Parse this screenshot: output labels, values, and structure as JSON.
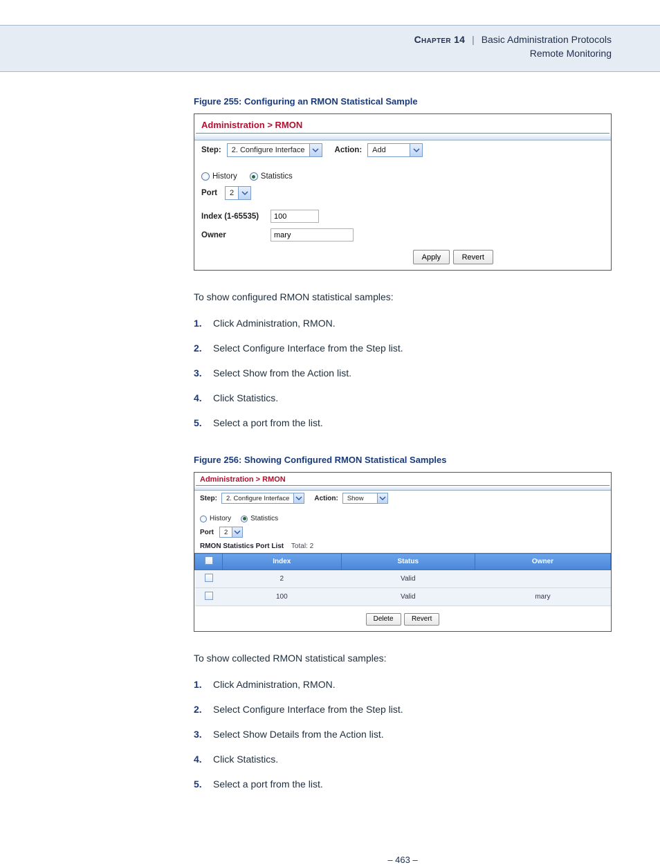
{
  "header": {
    "chapter_label": "Chapter 14",
    "chapter_title": "Basic Administration Protocols",
    "subtitle": "Remote Monitoring"
  },
  "figure255": {
    "caption": "Figure 255:  Configuring an RMON Statistical Sample",
    "breadcrumb": "Administration > RMON",
    "step_label": "Step:",
    "step_value": "2. Configure Interface",
    "action_label": "Action:",
    "action_value": "Add",
    "radio_history": "History",
    "radio_stats": "Statistics",
    "port_label": "Port",
    "port_value": "2",
    "index_label": "Index (1-65535)",
    "index_value": "100",
    "owner_label": "Owner",
    "owner_value": "mary",
    "apply_btn": "Apply",
    "revert_btn": "Revert"
  },
  "intro1": "To show configured RMON statistical samples:",
  "steps1": [
    "Click Administration, RMON.",
    "Select Configure Interface from the Step list.",
    "Select Show from the Action list.",
    "Click Statistics.",
    "Select a port from the list."
  ],
  "figure256": {
    "caption": "Figure 256:  Showing Configured RMON Statistical Samples",
    "breadcrumb": "Administration > RMON",
    "step_label": "Step:",
    "step_value": "2. Configure Interface",
    "action_label": "Action:",
    "action_value": "Show",
    "radio_history": "History",
    "radio_stats": "Statistics",
    "port_label": "Port",
    "port_value": "2",
    "list_title": "RMON Statistics Port List",
    "total_label": "Total: 2",
    "cols": [
      "Index",
      "Status",
      "Owner"
    ],
    "rows": [
      {
        "index": "2",
        "status": "Valid",
        "owner": ""
      },
      {
        "index": "100",
        "status": "Valid",
        "owner": "mary"
      }
    ],
    "delete_btn": "Delete",
    "revert_btn": "Revert"
  },
  "intro2": "To show collected RMON statistical samples:",
  "steps2": [
    "Click Administration, RMON.",
    "Select Configure Interface from the Step list.",
    "Select Show Details from the Action list.",
    "Click Statistics.",
    "Select a port from the list."
  ],
  "page_number": "–  463  –"
}
